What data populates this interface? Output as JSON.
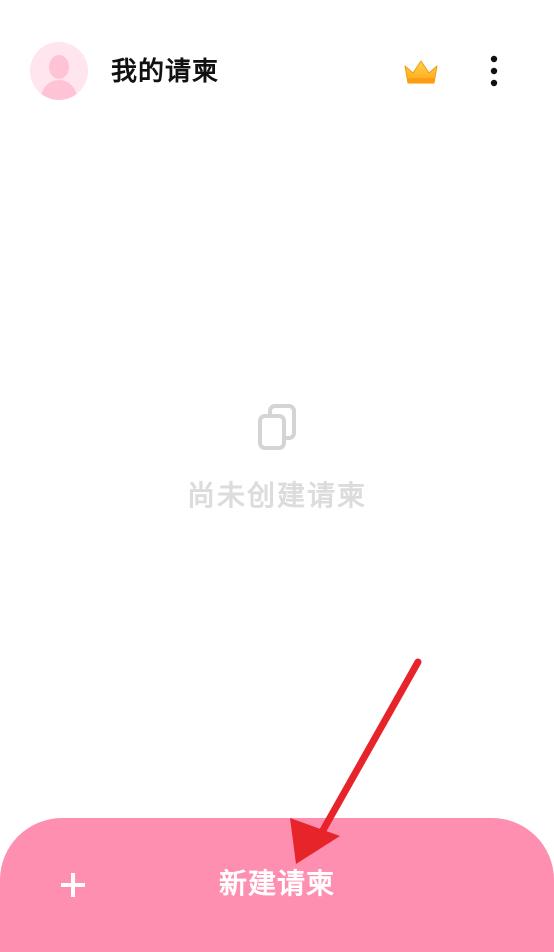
{
  "header": {
    "title": "我的请柬",
    "avatar_icon": "avatar-placeholder-icon",
    "vip_icon": "crown-icon",
    "menu_icon": "more-vertical-icon"
  },
  "empty_state": {
    "icon": "copy-icon",
    "text": "尚未创建请柬"
  },
  "bottom_bar": {
    "icon": "plus-icon",
    "label": "新建请柬"
  },
  "colors": {
    "accent": "#ff8fb1",
    "avatar_bg": "#ffe6ee",
    "avatar_figure": "#ffc3d6",
    "crown": "#ffb020",
    "empty_text": "#dcdcdc",
    "annotation_arrow": "#e8242b"
  }
}
